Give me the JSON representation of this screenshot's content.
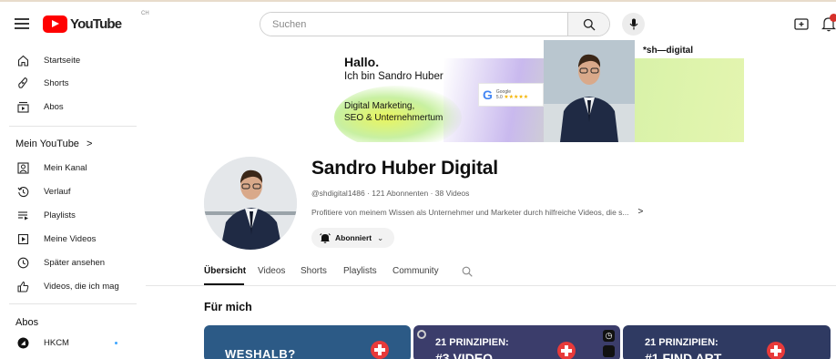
{
  "app": {
    "name": "YouTube",
    "country_code": "CH"
  },
  "search": {
    "placeholder": "Suchen"
  },
  "sidebar": {
    "main": [
      {
        "label": "Startseite",
        "icon": "home-icon"
      },
      {
        "label": "Shorts",
        "icon": "shorts-icon"
      },
      {
        "label": "Abos",
        "icon": "subscriptions-icon"
      }
    ],
    "you_section_title": "Mein YouTube",
    "you_section_arrow": ">",
    "you": [
      {
        "label": "Mein Kanal",
        "icon": "your-channel-icon"
      },
      {
        "label": "Verlauf",
        "icon": "history-icon"
      },
      {
        "label": "Playlists",
        "icon": "playlists-icon"
      },
      {
        "label": "Meine Videos",
        "icon": "your-videos-icon"
      },
      {
        "label": "Später ansehen",
        "icon": "watch-later-icon"
      },
      {
        "label": "Videos, die ich mag",
        "icon": "liked-videos-icon"
      }
    ],
    "subs_title": "Abos",
    "subscriptions": [
      {
        "label": "HKCM",
        "icon": "channel-avatar",
        "new_content": true
      }
    ]
  },
  "banner": {
    "greeting": "Hallo.",
    "intro": "Ich bin Sandro Huber",
    "topics_line1": "Digital Marketing,",
    "topics_line2": "SEO & Unternehmertum",
    "google_label": "Google",
    "google_rating": "5.0",
    "google_stars": "★★★★★",
    "brand": "*sh—digital"
  },
  "channel": {
    "name": "Sandro Huber Digital",
    "meta": "@shdigital1486 · 121 Abonnenten · 38 Videos",
    "description": "Profitiere von meinem Wissen als Unternehmer und Marketer durch hilfreiche Videos, die s...",
    "description_more": ">",
    "subscribe_label": "Abonniert",
    "subscribe_chevron": "⌄"
  },
  "tabs": [
    {
      "label": "Übersicht",
      "active": true
    },
    {
      "label": "Videos",
      "active": false
    },
    {
      "label": "Shorts",
      "active": false
    },
    {
      "label": "Playlists",
      "active": false
    },
    {
      "label": "Community",
      "active": false
    }
  ],
  "section_title": "Für mich",
  "videos": [
    {
      "title": "WESHALB?"
    },
    {
      "title_line1": "21 PRINZIPIEN:",
      "title_line2": "#3 VIDEO"
    },
    {
      "title_line1": "21 PRINZIPIEN:",
      "title_line2": "#1 FIND ART"
    }
  ],
  "colors": {
    "brand_red": "#ff0000",
    "text_primary": "#0f0f0f",
    "text_secondary": "#606060",
    "chip_bg": "#f2f2f2",
    "notification": "#d6312a"
  }
}
